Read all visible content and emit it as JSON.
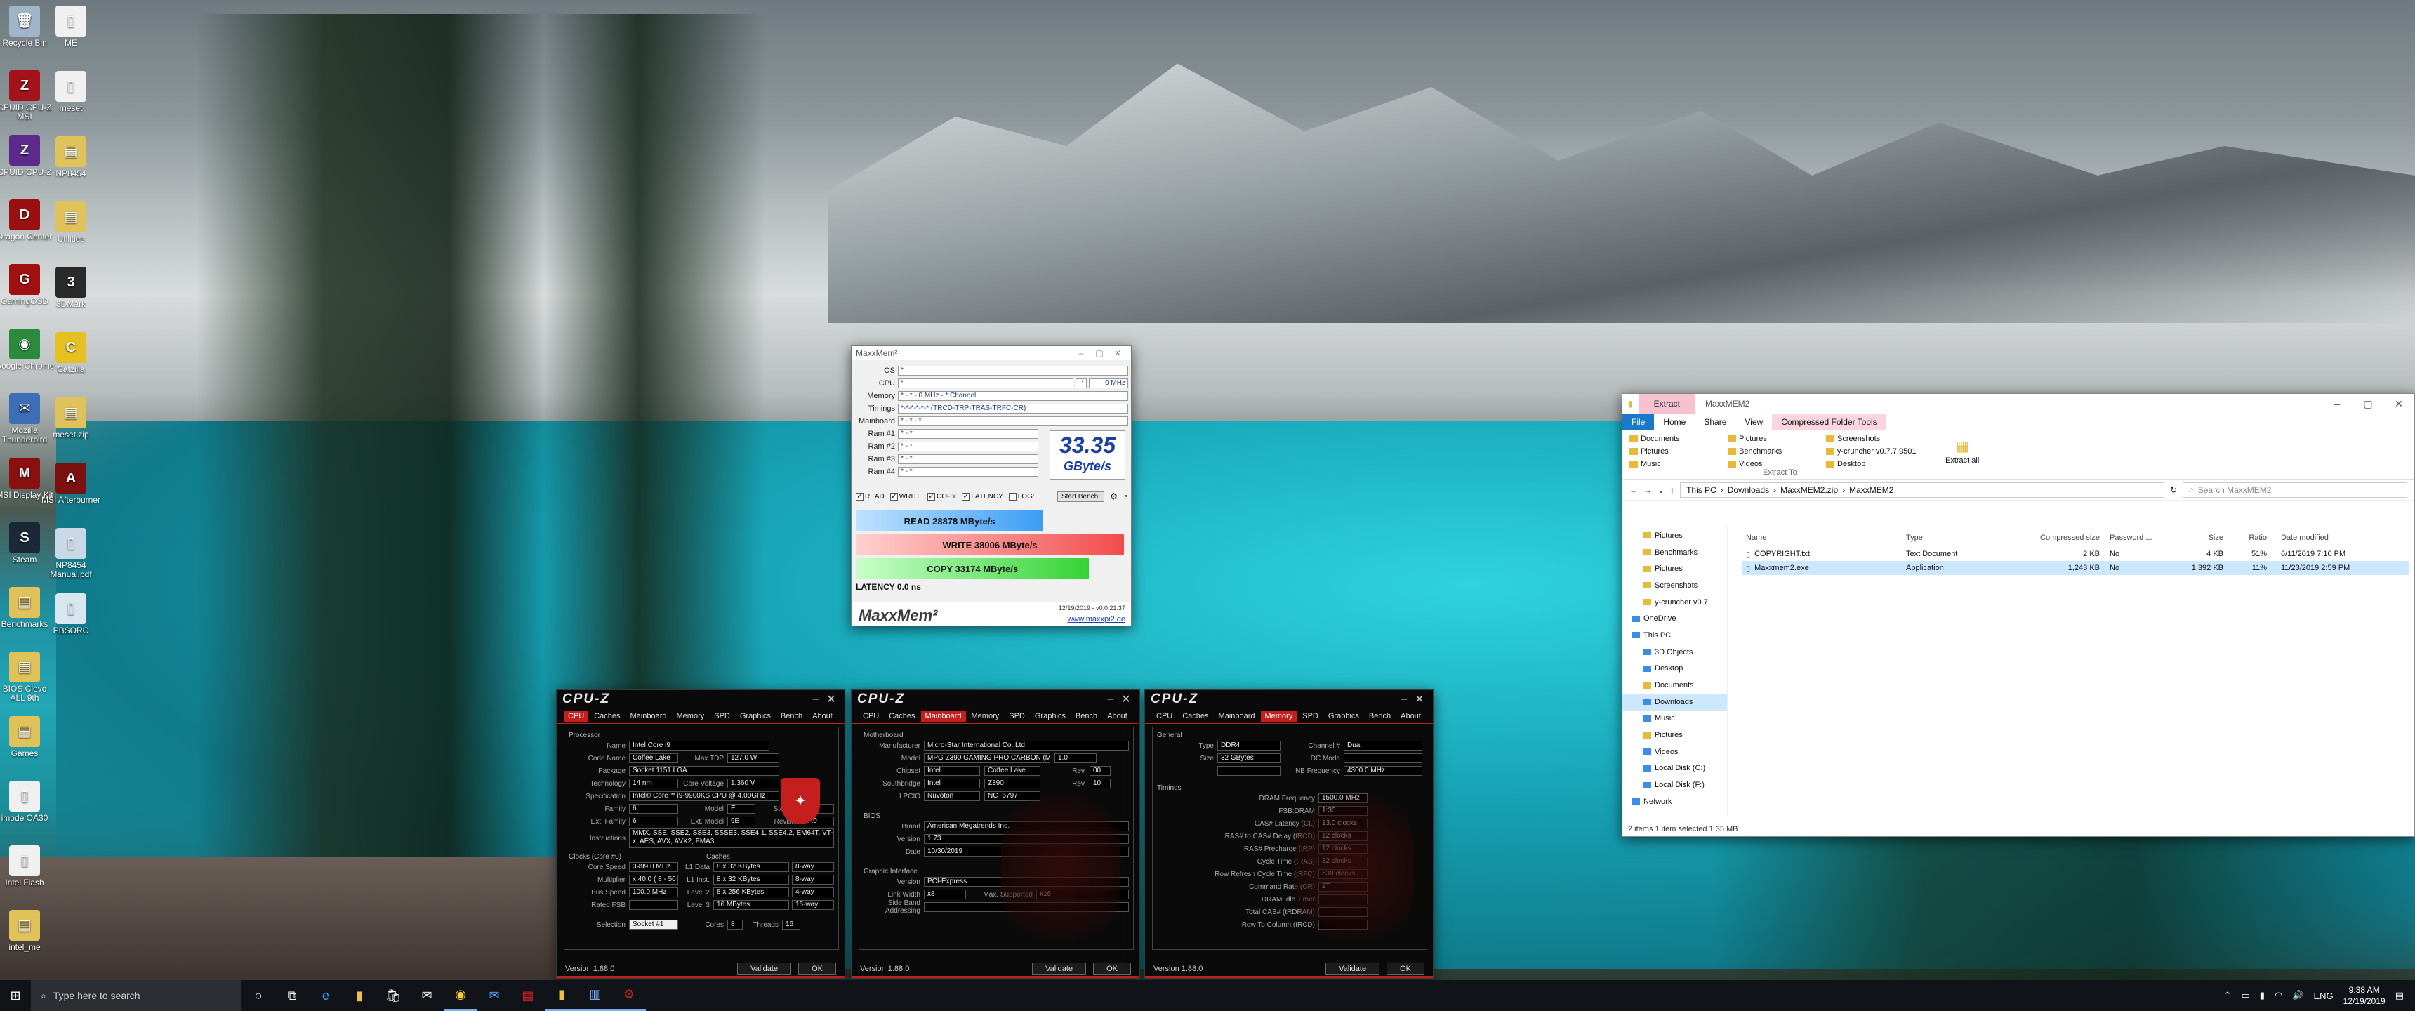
{
  "desktop_icons": [
    {
      "label": "Recycle Bin",
      "color": "#9fb6c9",
      "glyph": "🗑"
    },
    {
      "label": "CPUID CPU-Z MSI",
      "color": "#a3131b",
      "glyph": "Z"
    },
    {
      "label": "CPUID CPU-Z",
      "color": "#5b2a8c",
      "glyph": "Z"
    },
    {
      "label": "Dragon Center",
      "color": "#9a1010",
      "glyph": "D"
    },
    {
      "label": "GamingOSD",
      "color": "#a01010",
      "glyph": "G"
    },
    {
      "label": "Google Chrome",
      "color": "#2b8a3e",
      "glyph": "◉"
    },
    {
      "label": "Mozilla Thunderbird",
      "color": "#3d6fb7",
      "glyph": "✉"
    },
    {
      "label": "MSI Display Kit",
      "color": "#8a1010",
      "glyph": "M"
    },
    {
      "label": "Steam",
      "color": "#1b2838",
      "glyph": "S"
    },
    {
      "label": "Benchmarks",
      "color": "#e0c25a",
      "glyph": "▤"
    },
    {
      "label": "BIOS Clevo ALL 9th",
      "color": "#e0c25a",
      "glyph": "▤"
    },
    {
      "label": "Games",
      "color": "#e0c25a",
      "glyph": "▤"
    },
    {
      "label": "imode OA30",
      "color": "#f0f0f0",
      "glyph": "▯"
    },
    {
      "label": "Intel Flash",
      "color": "#f0f0f0",
      "glyph": "▯"
    },
    {
      "label": "intel_me",
      "color": "#e0c25a",
      "glyph": "▤"
    }
  ],
  "desktop_icons_col2": [
    {
      "label": "ME",
      "color": "#f0f0f0",
      "glyph": "▯"
    },
    {
      "label": "meset",
      "color": "#f0f0f0",
      "glyph": "▯"
    },
    {
      "label": "NP8454",
      "color": "#e0c25a",
      "glyph": "▤"
    },
    {
      "label": "Utilities",
      "color": "#e0c25a",
      "glyph": "▤"
    },
    {
      "label": "3DMark",
      "color": "#2a2a2a",
      "glyph": "3"
    },
    {
      "label": "Catzilla",
      "color": "#e6c021",
      "glyph": "C"
    },
    {
      "label": "meset.zip",
      "color": "#e0c25a",
      "glyph": "▤"
    },
    {
      "label": "MSI Afterburner",
      "color": "#7a1010",
      "glyph": "A"
    },
    {
      "label": "NP8454 Manual.pdf",
      "color": "#c9d8e6",
      "glyph": "▯"
    },
    {
      "label": "PBSORC",
      "color": "#d8e6f0",
      "glyph": "▯"
    }
  ],
  "maxxmem": {
    "title": "MaxxMem²",
    "rows": [
      {
        "k": "OS",
        "v": "*"
      },
      {
        "k": "CPU",
        "v": "*",
        "v2": "0 MHz",
        "sep": "*"
      },
      {
        "k": "Memory",
        "v": "* - * - 0 MHz - * Channel"
      },
      {
        "k": "Timings",
        "v": "*-*-*-*-*-* (TRCD-TRP-TRAS-TRFC-CR)"
      },
      {
        "k": "Mainboard",
        "v": "* - * - *"
      },
      {
        "k": "Ram #1",
        "v": "* - *"
      },
      {
        "k": "Ram #2",
        "v": "* - *"
      },
      {
        "k": "Ram #3",
        "v": "* - *"
      },
      {
        "k": "Ram #4",
        "v": "* - *"
      }
    ],
    "score_value": "33.35",
    "score_unit": "GByte/s",
    "checks": [
      "READ",
      "WRITE",
      "COPY",
      "LATENCY",
      "LOG:"
    ],
    "start_bench": "Start Bench!",
    "read_label": "READ  28878  MByte/s",
    "read_fraction": 0.7,
    "write_label": "WRITE  38006  MByte/s",
    "write_fraction": 1.0,
    "copy_label": "COPY  33174  MByte/s",
    "copy_fraction": 0.87,
    "latency_label": "LATENCY  0.0  ns",
    "logo": "MaxxMem²",
    "version": "12/19/2019 - v0.0.21.37",
    "url": "www.maxxpi2.de"
  },
  "cpuz_tabs": [
    "CPU",
    "Caches",
    "Mainboard",
    "Memory",
    "SPD",
    "Graphics",
    "Bench",
    "About"
  ],
  "cpuz1": {
    "title": "CPU-Z",
    "active": "CPU",
    "processor_label": "Processor",
    "fields": [
      {
        "k": "Name",
        "v": "Intel Core i9"
      },
      {
        "k": "Code Name",
        "v": "Coffee Lake",
        "k2": "Max TDP",
        "v2": "127.0 W"
      },
      {
        "k": "Package",
        "v": "Socket 1151 LGA"
      },
      {
        "k": "Technology",
        "v": "14 nm",
        "k2": "Core Voltage",
        "v2": "1.360 V"
      },
      {
        "k": "Specification",
        "v": "Intel® Core™ i9-9900KS CPU @ 4.00GHz"
      },
      {
        "k": "Family",
        "v": "6",
        "k2": "Model",
        "v2": "E"
      },
      {
        "k": "Ext. Family",
        "v": "6",
        "k2": "Ext. Model",
        "v2": "9E"
      },
      {
        "k": "Instructions",
        "v": "MMX, SSE, SSE2, SSE3, SSSE3, SSE4.1, SSE4.2, EM64T, VT-x, AES, AVX, AVX2, FMA3"
      }
    ],
    "clocks_label": "Clocks (Core #0)",
    "cache_label": "Caches",
    "clocks": [
      {
        "k": "Core Speed",
        "v": "3999.0 MHz",
        "k2": "L1 Data",
        "v2": "8 x 32 KBytes",
        "w": "8-way"
      },
      {
        "k": "Multiplier",
        "v": "x 40.0 ( 8 - 50 )",
        "k2": "L1 Inst.",
        "v2": "8 x 32 KBytes",
        "w": "8-way"
      },
      {
        "k": "Bus Speed",
        "v": "100.0 MHz",
        "k2": "Level 2",
        "v2": "8 x 256 KBytes",
        "w": "4-way"
      },
      {
        "k": "Rated FSB",
        "v": "",
        "k2": "Level 3",
        "v2": "16 MBytes",
        "w": "16-way"
      }
    ],
    "selection_label": "Selection",
    "selection": "Socket #1",
    "cores_label": "Cores",
    "cores": "8",
    "threads_label": "Threads",
    "threads": "16",
    "stepping_label": "Stepping",
    "stepping": "D",
    "revision_label": "Revision",
    "revision": "R0",
    "version": "Version 1.88.0",
    "validate": "Validate",
    "ok": "OK"
  },
  "cpuz2": {
    "title": "CPU-Z",
    "active": "Mainboard",
    "motherboard_label": "Motherboard",
    "fields": [
      {
        "k": "Manufacturer",
        "v": "Micro-Star International Co. Ltd."
      },
      {
        "k": "Model",
        "v": "MPG Z390 GAMING PRO CARBON (MS-",
        "v2": "1.0"
      },
      {
        "k": "Chipset",
        "v": "Intel",
        "v2": "Coffee Lake",
        "k3": "Rev.",
        "v3": "00"
      },
      {
        "k": "Southbridge",
        "v": "Intel",
        "v2": "Z390",
        "k3": "Rev.",
        "v3": "10"
      },
      {
        "k": "LPCIO",
        "v": "Nuvoton",
        "v2": "NCT6797"
      }
    ],
    "bios_label": "BIOS",
    "bios": [
      {
        "k": "Brand",
        "v": "American Megatrends Inc."
      },
      {
        "k": "Version",
        "v": "1.73"
      },
      {
        "k": "Date",
        "v": "10/30/2019"
      }
    ],
    "graphic_label": "Graphic Interface",
    "gi": [
      {
        "k": "Version",
        "v": "PCI-Express"
      },
      {
        "k": "Link Width",
        "v": "x8",
        "k2": "Max. Supported",
        "v2": "x16"
      },
      {
        "k": "Side Band Addressing",
        "v": ""
      }
    ],
    "version": "Version 1.88.0",
    "validate": "Validate",
    "ok": "OK"
  },
  "cpuz3": {
    "title": "CPU-Z",
    "active": "Memory",
    "general_label": "General",
    "general": [
      {
        "k": "Type",
        "v": "DDR4",
        "k2": "Channel #",
        "v2": "Dual"
      },
      {
        "k": "Size",
        "v": "32 GBytes",
        "k2": "DC Mode",
        "v2": ""
      },
      {
        "k": "",
        "v": "",
        "k2": "NB Frequency",
        "v2": "4300.0 MHz"
      }
    ],
    "timings_label": "Timings",
    "timings": [
      {
        "k": "DRAM Frequency",
        "v": "1500.0 MHz"
      },
      {
        "k": "FSB:DRAM",
        "v": "1:30"
      },
      {
        "k": "CAS# Latency (CL)",
        "v": "13.0 clocks"
      },
      {
        "k": "RAS# to CAS# Delay (tRCD)",
        "v": "12 clocks"
      },
      {
        "k": "RAS# Precharge (tRP)",
        "v": "12 clocks"
      },
      {
        "k": "Cycle Time (tRAS)",
        "v": "32 clocks"
      },
      {
        "k": "Row Refresh Cycle Time (tRFC)",
        "v": "539 clocks"
      },
      {
        "k": "Command Rate (CR)",
        "v": "2T"
      },
      {
        "k": "DRAM Idle Timer",
        "v": ""
      },
      {
        "k": "Total CAS# (tRDRAM)",
        "v": ""
      },
      {
        "k": "Row To Column (tRCD)",
        "v": ""
      }
    ],
    "version": "Version 1.88.0",
    "validate": "Validate",
    "ok": "OK"
  },
  "explorer": {
    "extract_tab": "Extract",
    "title": "MaxxMEM2",
    "ribbon": [
      "File",
      "Home",
      "Share",
      "View",
      "Compressed Folder Tools"
    ],
    "extract_to_items": [
      "Documents",
      "Pictures",
      "Music",
      "Pictures",
      "Benchmarks",
      "Videos",
      "Screenshots",
      "y-cruncher v0.7.7.9501",
      "Desktop"
    ],
    "extract_all": "Extract all",
    "extract_to_label": "Extract To",
    "path": [
      "This PC",
      "Downloads",
      "MaxxMEM2.zip",
      "MaxxMEM2"
    ],
    "search_placeholder": "Search MaxxMEM2",
    "nav": [
      {
        "label": "Pictures",
        "lvl": 1,
        "blue": false
      },
      {
        "label": "Benchmarks",
        "lvl": 1,
        "blue": false
      },
      {
        "label": "Pictures",
        "lvl": 1,
        "blue": false
      },
      {
        "label": "Screenshots",
        "lvl": 1,
        "blue": false
      },
      {
        "label": "y-cruncher v0.7.",
        "lvl": 1,
        "blue": false
      },
      {
        "label": "OneDrive",
        "lvl": 0,
        "blue": true
      },
      {
        "label": "This PC",
        "lvl": 0,
        "blue": true
      },
      {
        "label": "3D Objects",
        "lvl": 1,
        "blue": true
      },
      {
        "label": "Desktop",
        "lvl": 1,
        "blue": true
      },
      {
        "label": "Documents",
        "lvl": 1,
        "blue": false
      },
      {
        "label": "Downloads",
        "lvl": 1,
        "blue": true,
        "sel": true
      },
      {
        "label": "Music",
        "lvl": 1,
        "blue": true
      },
      {
        "label": "Pictures",
        "lvl": 1,
        "blue": false
      },
      {
        "label": "Videos",
        "lvl": 1,
        "blue": true
      },
      {
        "label": "Local Disk (C:)",
        "lvl": 1,
        "blue": true
      },
      {
        "label": "Local Disk (F:)",
        "lvl": 1,
        "blue": true
      },
      {
        "label": "Network",
        "lvl": 0,
        "blue": true
      }
    ],
    "columns": [
      "Name",
      "Type",
      "Compressed size",
      "Password ...",
      "Size",
      "Ratio",
      "Date modified"
    ],
    "files": [
      {
        "name": "COPYRIGHT.txt",
        "type": "Text Document",
        "csize": "2 KB",
        "pw": "No",
        "size": "4 KB",
        "ratio": "51%",
        "date": "6/11/2019 7:10 PM"
      },
      {
        "name": "Maxxmem2.exe",
        "type": "Application",
        "csize": "1,243 KB",
        "pw": "No",
        "size": "1,392 KB",
        "ratio": "11%",
        "date": "11/23/2019 2:59 PM"
      }
    ],
    "status": "2 items   1 item selected  1.35 MB"
  },
  "taskbar": {
    "search_placeholder": "Type here to search",
    "lang": "ENG",
    "time": "9:38 AM",
    "date": "12/19/2019"
  }
}
